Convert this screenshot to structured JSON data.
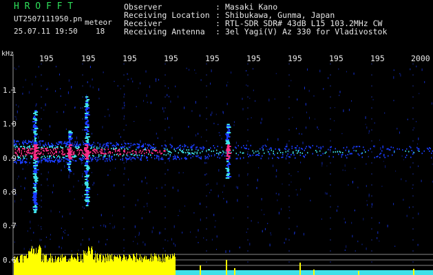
{
  "header": {
    "app_title": "H R O F F T",
    "file_name": "UT2507111950.pn",
    "event_type": "meteor",
    "date_time": "25.07.11 19:50",
    "count": "18"
  },
  "info": [
    {
      "label": "Observer",
      "value": "Masaki Kano"
    },
    {
      "label": "Receiving Location",
      "value": "Shibukawa, Gunma, Japan"
    },
    {
      "label": "Receiver",
      "value": "RTL-SDR SDR# 43dB L15 103.2MHz CW"
    },
    {
      "label": "Receiving Antenna",
      "value": "3el Yagi(V) Az 330 for Vladivostok"
    }
  ],
  "colon": ":",
  "axes": {
    "y_unit": "kHz",
    "y_ticks": [
      "1.1",
      "1.0",
      "0.9",
      "0.8",
      "0.7",
      "0.6"
    ],
    "x_ticks": [
      "195",
      "195",
      "195",
      "195",
      "195",
      "195",
      "195",
      "195",
      "195",
      "2000"
    ]
  },
  "colors": {
    "text_primary": "#3ee0e8",
    "title": "#2ee05a",
    "echo_strong": "#ff2e88",
    "echo_medium": "#3ee0e8",
    "echo_weak": "#1a3cff",
    "amplitude": "#ffff00"
  }
}
